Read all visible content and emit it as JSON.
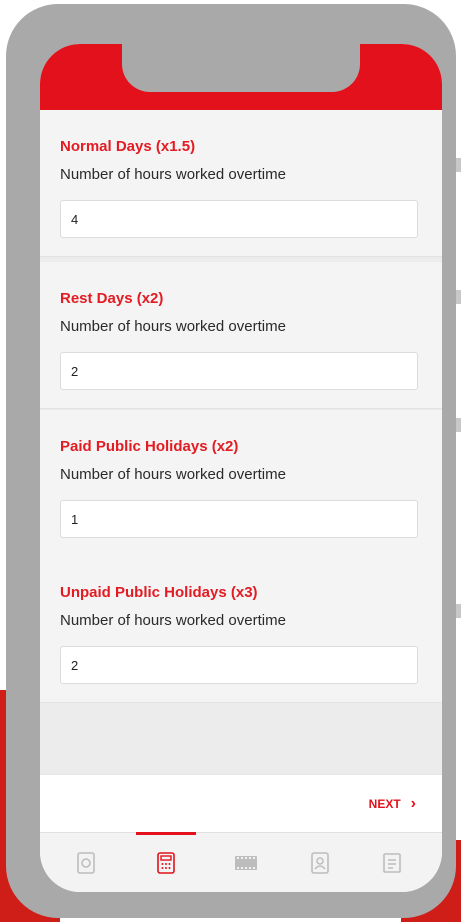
{
  "sections": [
    {
      "title": "Normal Days (x1.5)",
      "subtitle": "Number of hours worked overtime",
      "value": "4"
    },
    {
      "title": "Rest Days (x2)",
      "subtitle": "Number of hours worked overtime",
      "value": "2"
    },
    {
      "title": "Paid Public Holidays (x2)",
      "subtitle": "Number of hours worked overtime",
      "value": "1"
    },
    {
      "title": "Unpaid Public Holidays (x3)",
      "subtitle": "Number of hours worked overtime",
      "value": "2"
    }
  ],
  "footer": {
    "next_label": "NEXT",
    "next_icon": "chevron-right-icon"
  },
  "tabbar": {
    "active_tab": "calculator",
    "tabs": [
      {
        "id": "home",
        "icon": "dollar-coin-icon"
      },
      {
        "id": "calculator",
        "icon": "calculator-icon"
      },
      {
        "id": "video",
        "icon": "film-icon"
      },
      {
        "id": "profile",
        "icon": "id-badge-icon"
      },
      {
        "id": "list",
        "icon": "list-icon"
      }
    ]
  },
  "colors": {
    "accent": "#e3111b",
    "title_red": "#e31b23",
    "frame": "#a9a9a9",
    "tab_icon": "#bdbdbd"
  }
}
